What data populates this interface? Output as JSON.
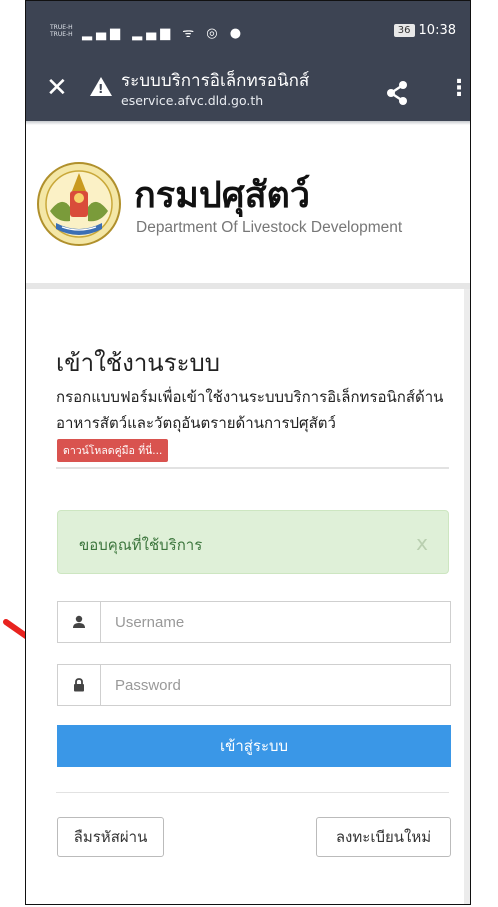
{
  "status_bar": {
    "carrier_line1": "TRUE-H",
    "carrier_line2": "TRUE-H",
    "battery": "36",
    "time": "10:38"
  },
  "browser": {
    "close_icon": "close-icon",
    "page_title": "ระบบบริการอิเล็กทรอนิกส์",
    "url": "eservice.afvc.dld.go.th"
  },
  "brand": {
    "name_th": "กรมปศุสัตว์",
    "name_en": "Department Of Livestock Development"
  },
  "login": {
    "title": "เข้าใช้งานระบบ",
    "description": "กรอกแบบฟอร์มเพื่อเข้าใช้งานระบบบริการอิเล็กทรอนิกส์ด้านอาหารสัตว์และวัตถุอันตรายด้านการปศุสัตว์",
    "download_label": "ดาวน์โหลดคู่มือ ที่นี่...",
    "alert_text": "ขอบคุณที่ใช้บริการ",
    "alert_close": "x",
    "username_placeholder": "Username",
    "password_placeholder": "Password",
    "submit_label": "เข้าสู่ระบบ",
    "forgot_label": "ลืมรหัสผ่าน",
    "register_label": "ลงทะเบียนใหม่"
  },
  "colors": {
    "toolbar": "#3d4453",
    "primary": "#3a97e7",
    "danger": "#d9534f",
    "alert_bg": "#dff0d8",
    "alert_text": "#3c763d",
    "annotation_arrow": "#e8231f"
  }
}
